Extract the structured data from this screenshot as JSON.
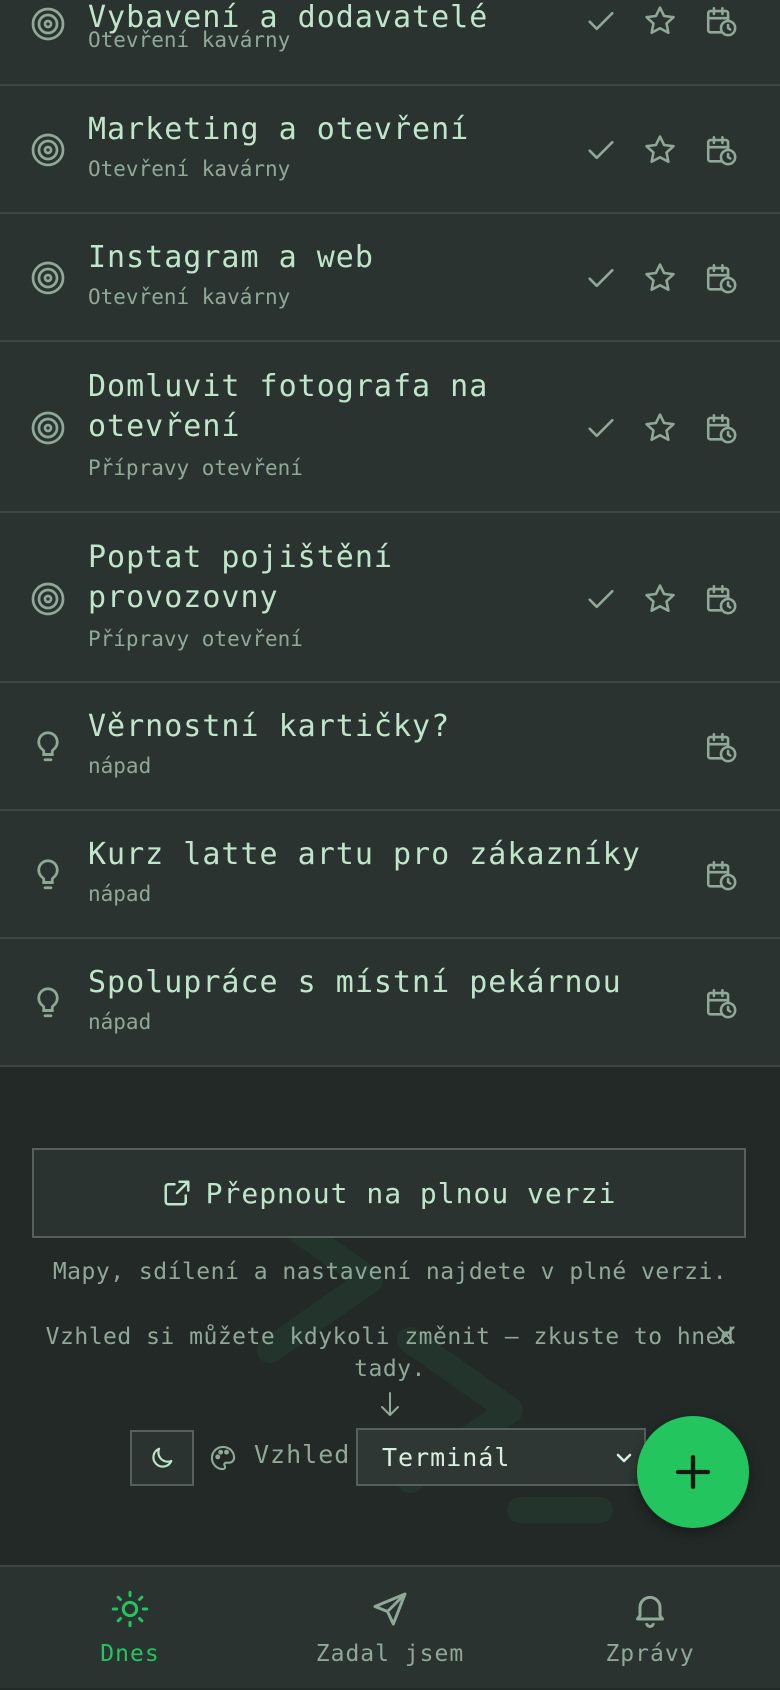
{
  "tasks": [
    {
      "title": "Vybavení a dodavatelé",
      "subtitle": "Otevření kavárny",
      "kind": "goal"
    },
    {
      "title": "Marketing a otevření",
      "subtitle": "Otevření kavárny",
      "kind": "goal"
    },
    {
      "title": "Instagram a web",
      "subtitle": "Otevření kavárny",
      "kind": "goal"
    },
    {
      "title": "Domluvit fotografa na otevření",
      "subtitle": "Přípravy otevření",
      "kind": "goal"
    },
    {
      "title": "Poptat pojištění provozovny",
      "subtitle": "Přípravy otevření",
      "kind": "goal"
    },
    {
      "title": "Věrnostní kartičky?",
      "subtitle": "nápad",
      "kind": "idea"
    },
    {
      "title": "Kurz latte artu pro zákazníky",
      "subtitle": "nápad",
      "kind": "idea"
    },
    {
      "title": "Spolupráce s místní pekárnou",
      "subtitle": "nápad",
      "kind": "idea"
    }
  ],
  "footer": {
    "switch_label": "Přepnout na plnou verzi",
    "info_text": "Mapy, sdílení a nastavení najdete v plné verzi.",
    "hint_text": "Vzhled si můžete kdykoli změnit — zkuste to hned tady.",
    "appearance_label": "Vzhled",
    "theme_value": "Terminál"
  },
  "nav": {
    "today": "Dnes",
    "assigned": "Zadal jsem",
    "messages": "Zprávy"
  },
  "colors": {
    "accent": "#22c55e",
    "background": "#222927",
    "row": "#2b3331",
    "text": "#bfe6c8",
    "muted": "#8fa898"
  },
  "icons": {
    "goal": "target-icon",
    "idea": "lightbulb-icon",
    "done": "check-icon",
    "star": "star-icon",
    "schedule": "calendar-clock-icon"
  }
}
